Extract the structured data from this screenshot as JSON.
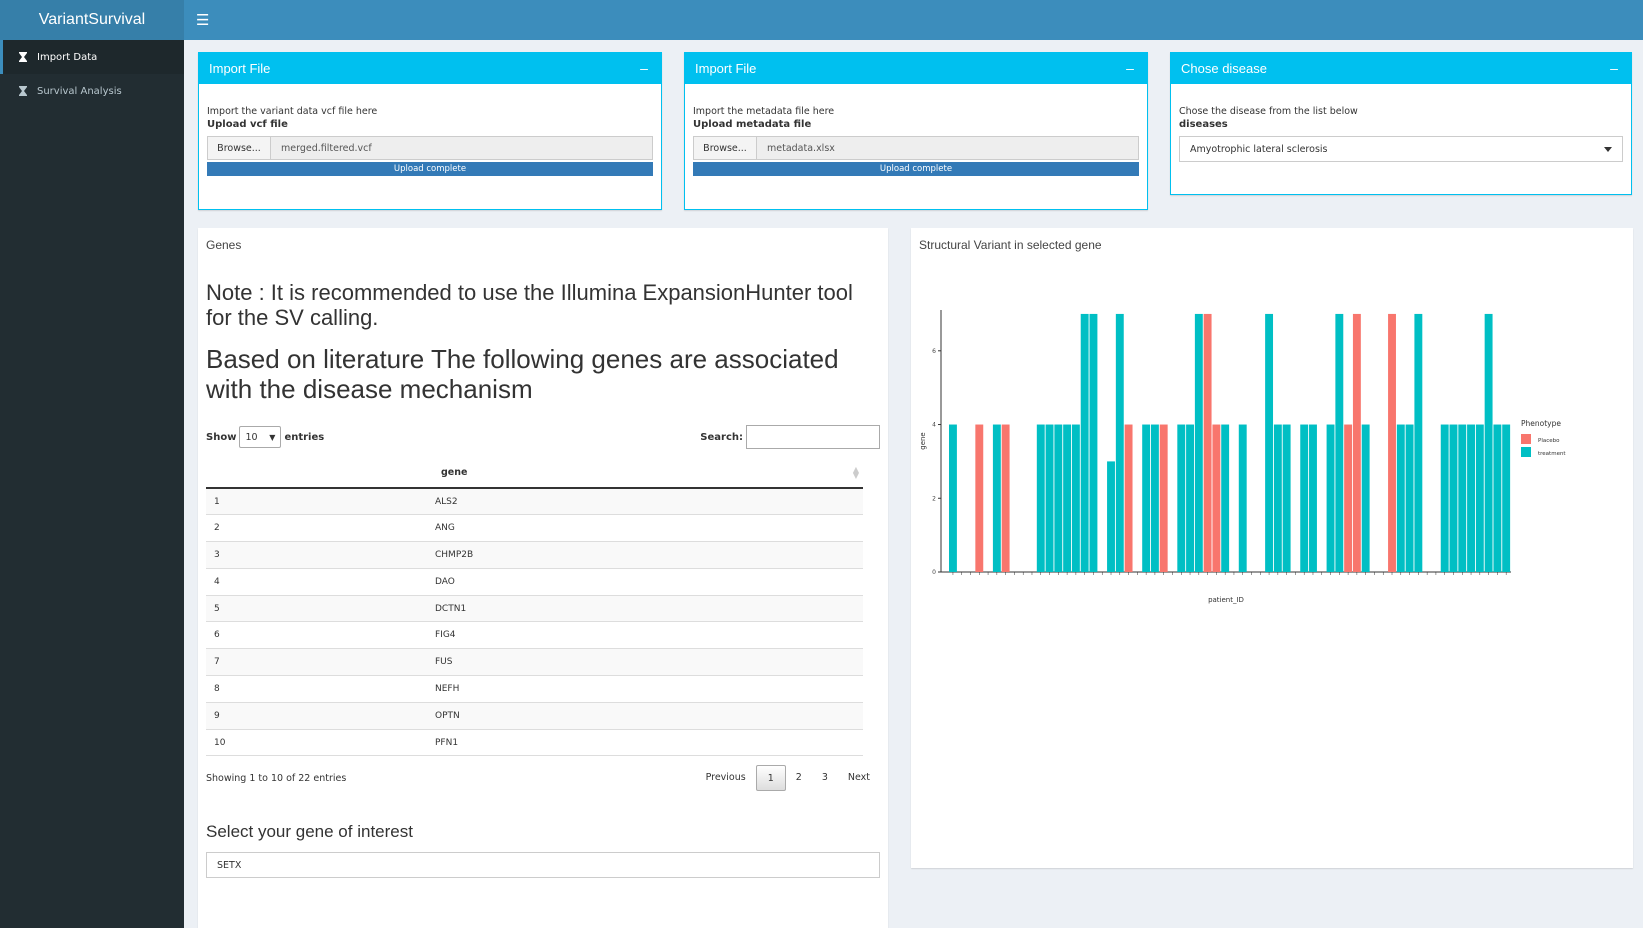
{
  "app": {
    "title": "VariantSurvival"
  },
  "sidebar": {
    "items": [
      {
        "label": "Import Data",
        "icon": "hourglass-icon",
        "active": true
      },
      {
        "label": "Survival Analysis",
        "icon": "hourglass-icon",
        "active": false
      }
    ]
  },
  "import_vcf": {
    "title": "Import File",
    "help": "Import the variant data vcf file here",
    "label": "Upload vcf file",
    "browse": "Browse...",
    "filename": "merged.filtered.vcf",
    "status": "Upload complete"
  },
  "import_meta": {
    "title": "Import File",
    "help": "Import the metadata file here",
    "label": "Upload metadata file",
    "browse": "Browse...",
    "filename": "metadata.xlsx",
    "status": "Upload complete"
  },
  "disease": {
    "title": "Chose disease",
    "help": "Chose the disease from the list below",
    "label": "diseases",
    "selected": "Amyotrophic lateral sclerosis"
  },
  "genes": {
    "title": "Genes",
    "note": "Note : It is recommended to use the Illumina ExpansionHunter tool for the SV calling.",
    "heading": "Based on literature The following genes are associated with the disease mechanism",
    "show_label": "Show",
    "show_value": "10",
    "entries_label": "entries",
    "search_label": "Search:",
    "column": "gene",
    "rows": [
      {
        "n": "1",
        "gene": "ALS2"
      },
      {
        "n": "2",
        "gene": "ANG"
      },
      {
        "n": "3",
        "gene": "CHMP2B"
      },
      {
        "n": "4",
        "gene": "DAO"
      },
      {
        "n": "5",
        "gene": "DCTN1"
      },
      {
        "n": "6",
        "gene": "FIG4"
      },
      {
        "n": "7",
        "gene": "FUS"
      },
      {
        "n": "8",
        "gene": "NEFH"
      },
      {
        "n": "9",
        "gene": "OPTN"
      },
      {
        "n": "10",
        "gene": "PFN1"
      }
    ],
    "info": "Showing 1 to 10 of 22 entries",
    "pager": {
      "prev": "Previous",
      "pages": [
        "1",
        "2",
        "3"
      ],
      "next": "Next"
    },
    "select_label": "Select your gene of interest",
    "select_value": "SETX"
  },
  "sv_panel": {
    "title": "Structural Variant in selected gene"
  },
  "colors": {
    "placebo": "#f8766d",
    "treatment": "#00bfc4",
    "header": "#3c8dbc",
    "box": "#00c0ef"
  },
  "chart_data": {
    "type": "bar",
    "xlabel": "patient_ID",
    "ylabel": "gene",
    "ylim": [
      0,
      7
    ],
    "yticks": [
      "0",
      "2",
      "4",
      "6"
    ],
    "legend": {
      "title": "Phenotype",
      "placement": "right",
      "entries": [
        "Placebo",
        "treatment"
      ]
    },
    "values": [
      4,
      0,
      0,
      4,
      0,
      4,
      4,
      0,
      0,
      0,
      4,
      4,
      4,
      4,
      4,
      7,
      7,
      0,
      3,
      7,
      4,
      0,
      4,
      4,
      4,
      0,
      4,
      4,
      7,
      7,
      4,
      4,
      0,
      4,
      0,
      0,
      7,
      4,
      4,
      0,
      4,
      4,
      0,
      4,
      7,
      4,
      7,
      4,
      0,
      0,
      7,
      4,
      4,
      7,
      0,
      0,
      4,
      4,
      4,
      4,
      4,
      7,
      4,
      4
    ],
    "phenotype": [
      "t",
      "",
      "",
      "p",
      "",
      "t",
      "p",
      "",
      "",
      "",
      "t",
      "t",
      "t",
      "t",
      "t",
      "t",
      "t",
      "",
      "t",
      "t",
      "p",
      "",
      "t",
      "t",
      "p",
      "",
      "t",
      "t",
      "t",
      "p",
      "p",
      "t",
      "",
      "t",
      "",
      "",
      "t",
      "t",
      "t",
      "",
      "t",
      "t",
      "",
      "t",
      "t",
      "p",
      "p",
      "t",
      "",
      "",
      "p",
      "t",
      "t",
      "t",
      "",
      "",
      "t",
      "t",
      "t",
      "t",
      "t",
      "t",
      "t",
      "t"
    ]
  }
}
